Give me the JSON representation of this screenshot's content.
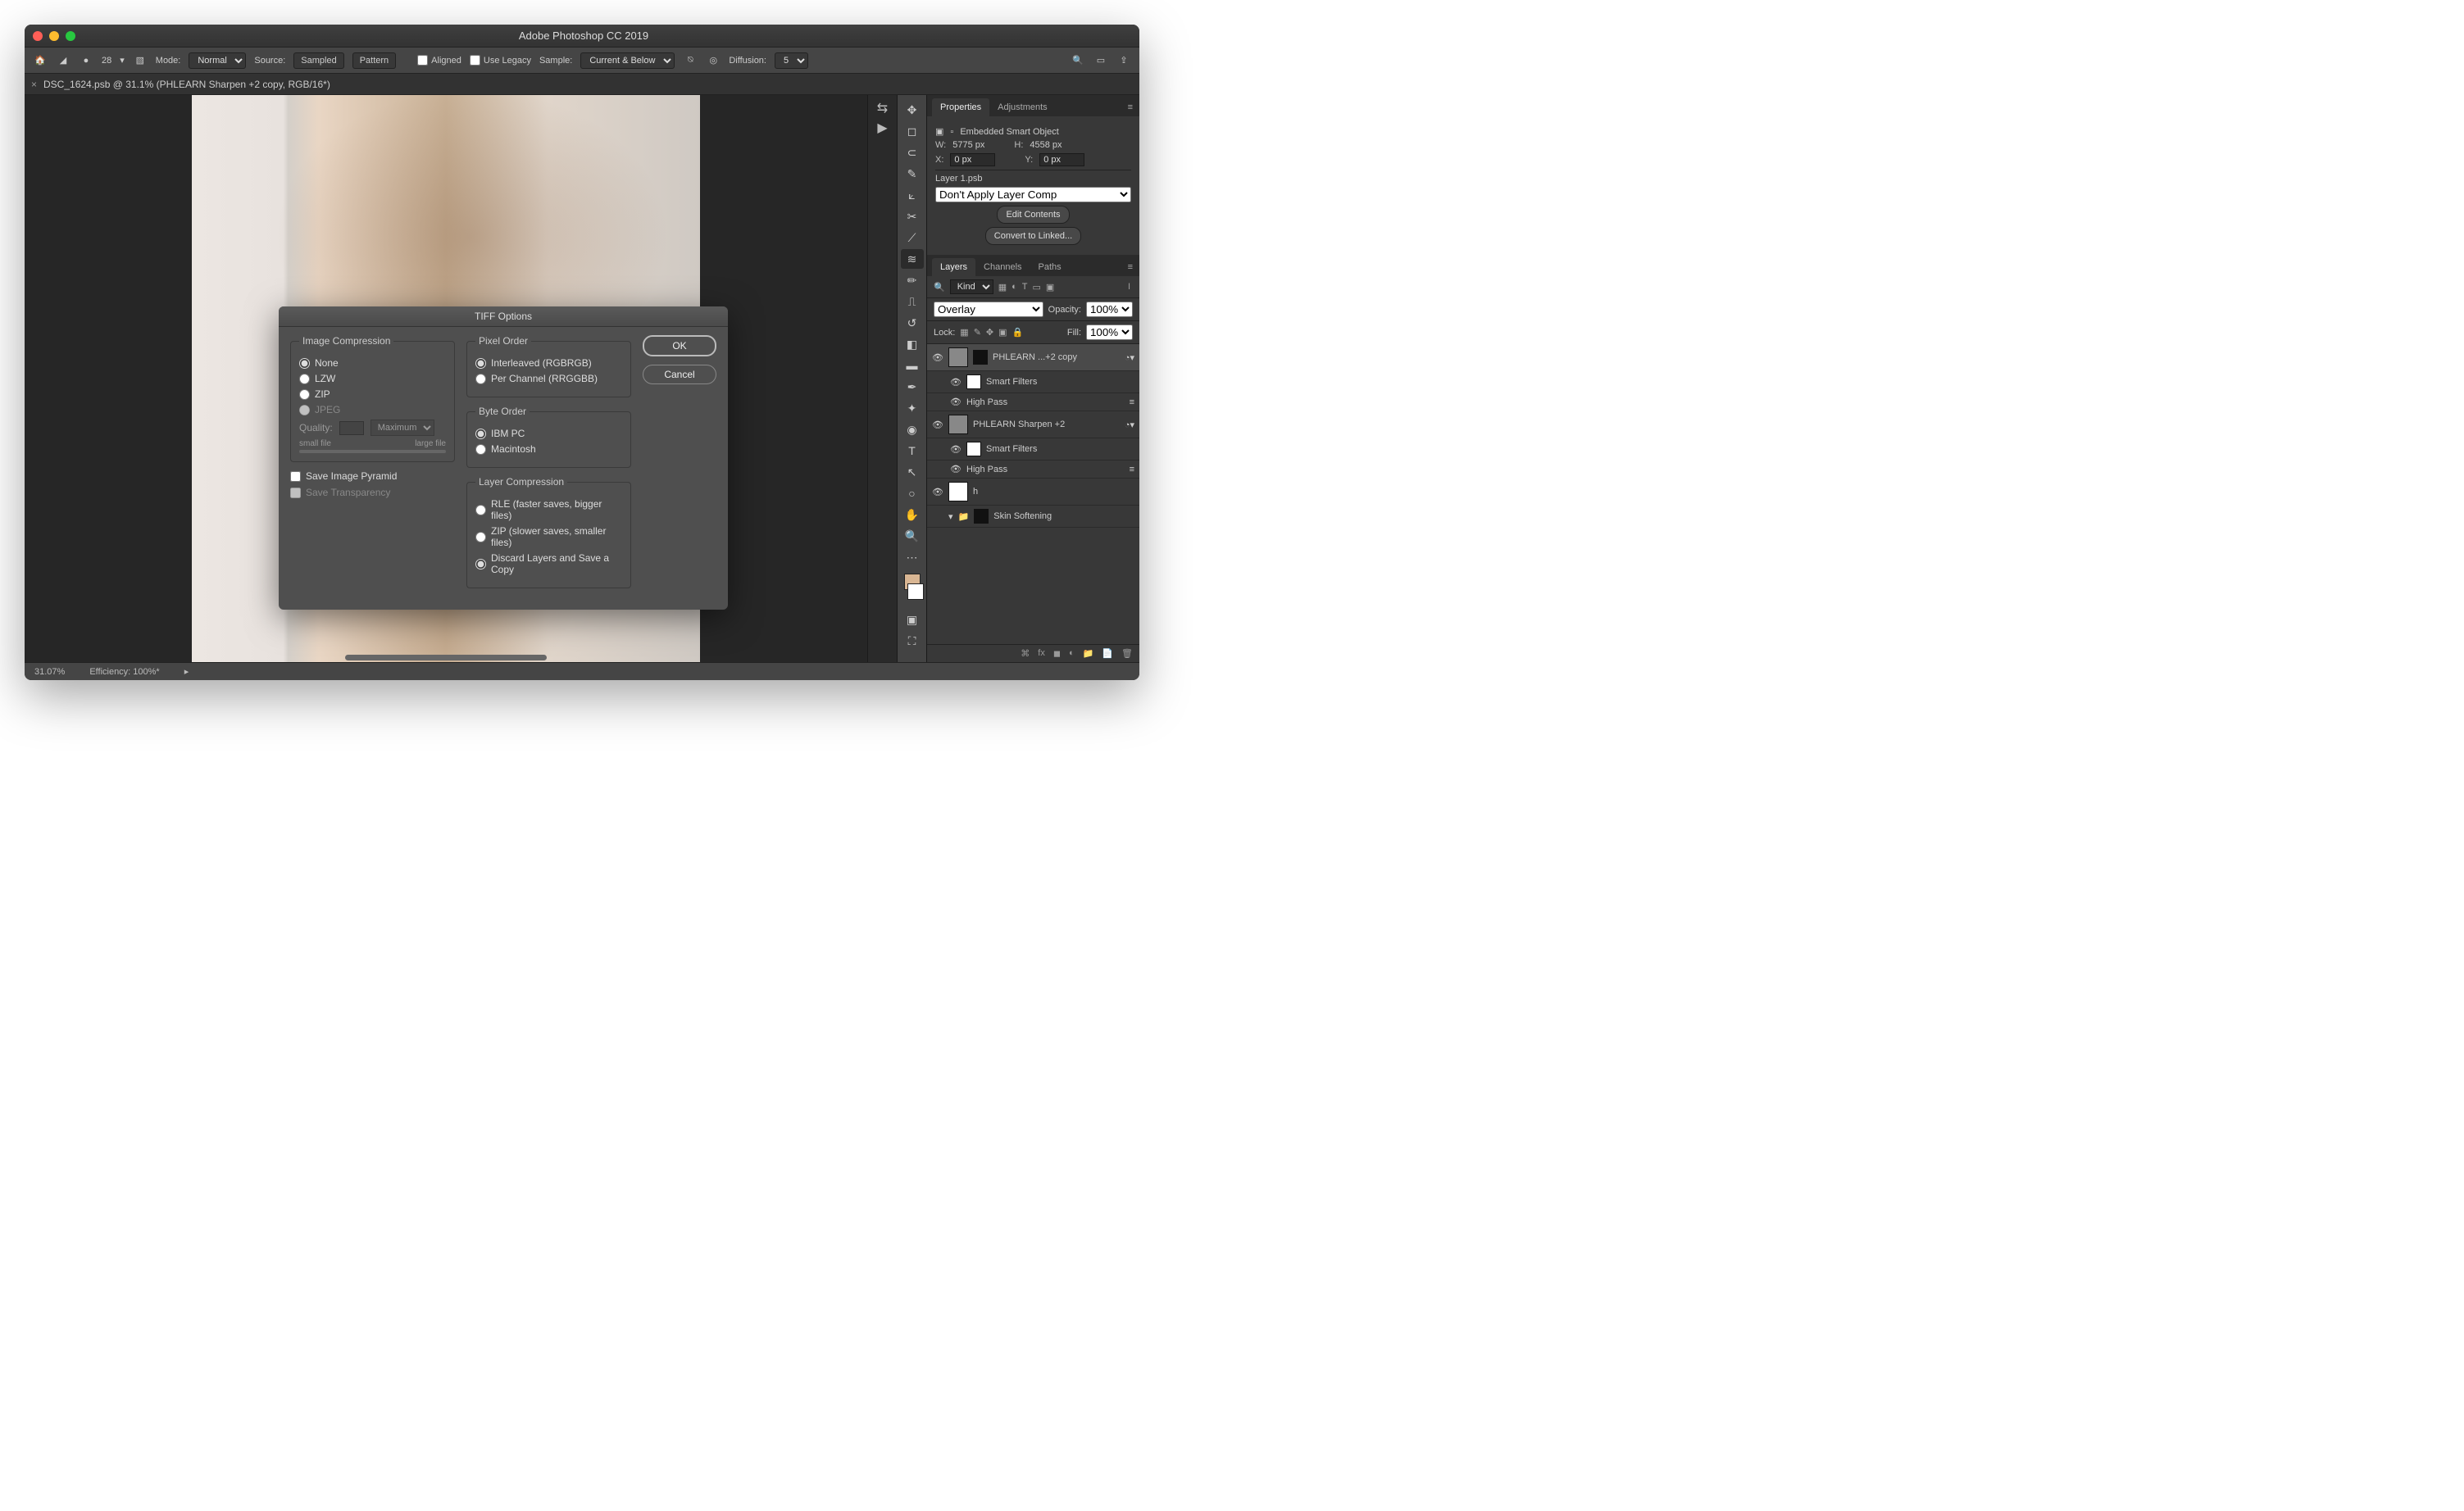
{
  "titlebar": {
    "title": "Adobe Photoshop CC 2019"
  },
  "optbar": {
    "brush_size": "28",
    "mode_label": "Mode:",
    "mode_value": "Normal",
    "source_label": "Source:",
    "sampled": "Sampled",
    "pattern": "Pattern",
    "aligned": "Aligned",
    "use_legacy": "Use Legacy",
    "sample_label": "Sample:",
    "sample_value": "Current & Below",
    "diffusion_label": "Diffusion:",
    "diffusion_value": "5"
  },
  "doc": {
    "tab": "DSC_1624.psb @ 31.1% (PHLEARN Sharpen +2 copy, RGB/16*)"
  },
  "status": {
    "zoom": "31.07%",
    "efficiency": "Efficiency: 100%*"
  },
  "properties": {
    "tab_properties": "Properties",
    "tab_adjustments": "Adjustments",
    "header": "Embedded Smart Object",
    "w_label": "W:",
    "w_value": "5775 px",
    "h_label": "H:",
    "h_value": "4558 px",
    "x_label": "X:",
    "x_value": "0 px",
    "y_label": "Y:",
    "y_value": "0 px",
    "layer_src": "Layer 1.psb",
    "layer_comp": "Don't Apply Layer Comp",
    "edit_contents": "Edit Contents",
    "convert_linked": "Convert to Linked..."
  },
  "layers_panel": {
    "tab_layers": "Layers",
    "tab_channels": "Channels",
    "tab_paths": "Paths",
    "kind_label": "Kind",
    "blend_mode": "Overlay",
    "opacity_label": "Opacity:",
    "opacity_value": "100%",
    "lock_label": "Lock:",
    "fill_label": "Fill:",
    "fill_value": "100%",
    "layers": [
      {
        "name": "PHLEARN ...+2 copy",
        "smart": "Smart Filters",
        "filter": "High Pass"
      },
      {
        "name": "PHLEARN Sharpen +2",
        "smart": "Smart Filters",
        "filter": "High Pass"
      },
      {
        "name": "h"
      },
      {
        "name": "Skin Softening"
      }
    ]
  },
  "dialog": {
    "title": "TIFF Options",
    "ok": "OK",
    "cancel": "Cancel",
    "image_compression": {
      "legend": "Image Compression",
      "none": "None",
      "lzw": "LZW",
      "zip": "ZIP",
      "jpeg": "JPEG",
      "quality_label": "Quality:",
      "quality_preset": "Maximum",
      "small": "small file",
      "large": "large file"
    },
    "save_pyramid": "Save Image Pyramid",
    "save_transparency": "Save Transparency",
    "pixel_order": {
      "legend": "Pixel Order",
      "interleaved": "Interleaved (RGBRGB)",
      "per_channel": "Per Channel (RRGGBB)"
    },
    "byte_order": {
      "legend": "Byte Order",
      "ibm": "IBM PC",
      "mac": "Macintosh"
    },
    "layer_compression": {
      "legend": "Layer Compression",
      "rle": "RLE (faster saves, bigger files)",
      "zip": "ZIP (slower saves, smaller files)",
      "discard": "Discard Layers and Save a Copy"
    }
  }
}
